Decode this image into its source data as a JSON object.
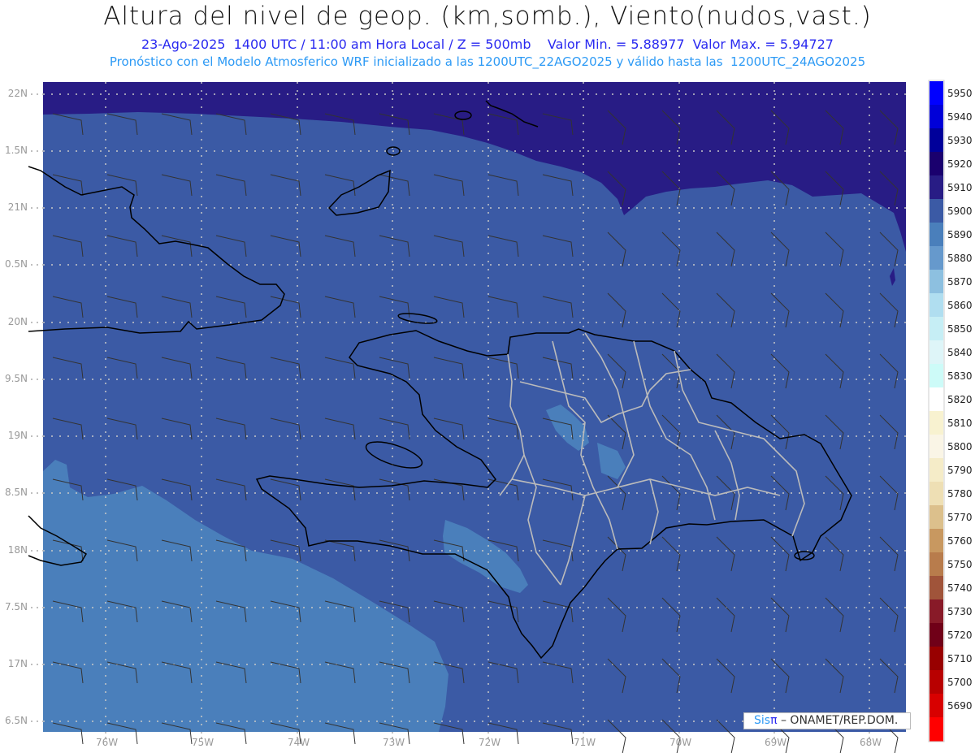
{
  "header": {
    "title": "Altura del nivel de geop. (km,somb.), Viento(nudos,vast.)",
    "subtitle": "23-Ago-2025  1400 UTC / 11:00 am Hora Local / Z = 500mb    Valor Min. = 5.88977  Valor Max. = 5.94727",
    "model_line": "Pronóstico con el Modelo Atmosferico WRF inicializado a las 1200UTC_22AGO2025 y válido hasta las  1200UTC_24AGO2025"
  },
  "map": {
    "lat_labels": [
      "22N",
      "1.5N",
      "21N",
      "0.5N",
      "20N",
      "9.5N",
      "19N",
      "8.5N",
      "18N",
      "7.5N",
      "17N",
      "6.5N"
    ],
    "lon_labels": [
      "76W",
      "75W",
      "74W",
      "73W",
      "72W",
      "71W",
      "70W",
      "69W",
      "68W"
    ],
    "colors": {
      "high": "#281c85",
      "main": "#3b5aa5",
      "low": "#4a7fbb",
      "lowest": "#6699cc"
    }
  },
  "colorbar": {
    "labels": [
      "5950",
      "5940",
      "5930",
      "5920",
      "5910",
      "5900",
      "5890",
      "5880",
      "5870",
      "5860",
      "5850",
      "5840",
      "5830",
      "5820",
      "5810",
      "5800",
      "5790",
      "5780",
      "5770",
      "5760",
      "5750",
      "5740",
      "5730",
      "5720",
      "5710",
      "5700",
      "5690"
    ],
    "colors": [
      "#0000ff",
      "#0000d8",
      "#00009a",
      "#1a006e",
      "#281c85",
      "#3b5aa5",
      "#4a7fbb",
      "#6699cc",
      "#8dc0e0",
      "#b0def0",
      "#c6eef5",
      "#def5f8",
      "#cdfbf8",
      "#ffffff",
      "#f8f2d0",
      "#faf5e6",
      "#f5ecc8",
      "#eedfb4",
      "#dcc08c",
      "#c89860",
      "#b87c4c",
      "#a0543a",
      "#881a28",
      "#700018",
      "#980000",
      "#b80000",
      "#d80000",
      "#ff0000"
    ]
  },
  "credit": {
    "sis": "Sis",
    "pi": "π",
    "text": "– ONAMET/REP.DOM."
  }
}
